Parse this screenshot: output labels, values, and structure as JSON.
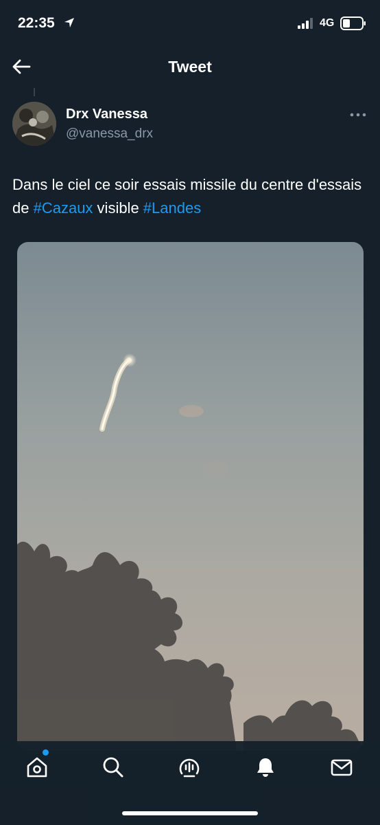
{
  "status_bar": {
    "time": "22:35",
    "network": "4G"
  },
  "header": {
    "title": "Tweet",
    "back_icon": "arrow-left-icon"
  },
  "tweet": {
    "author_name": "Drx Vanessa",
    "author_handle": "@vanessa_drx",
    "text_part1": "Dans le ciel ce soir essais missile du centre d'essais de ",
    "hashtag1": "#Cazaux",
    "text_part2": " visible ",
    "hashtag2": "#Landes",
    "media_description_icon": "photo"
  },
  "tab_bar": {
    "items": [
      {
        "icon": "home-icon"
      },
      {
        "icon": "search-icon"
      },
      {
        "icon": "spaces-icon"
      },
      {
        "icon": "bell-icon"
      },
      {
        "icon": "mail-icon"
      }
    ]
  },
  "colors": {
    "background": "#15202b",
    "accent": "#1d9bf0",
    "secondary_text": "#8b98a5"
  }
}
